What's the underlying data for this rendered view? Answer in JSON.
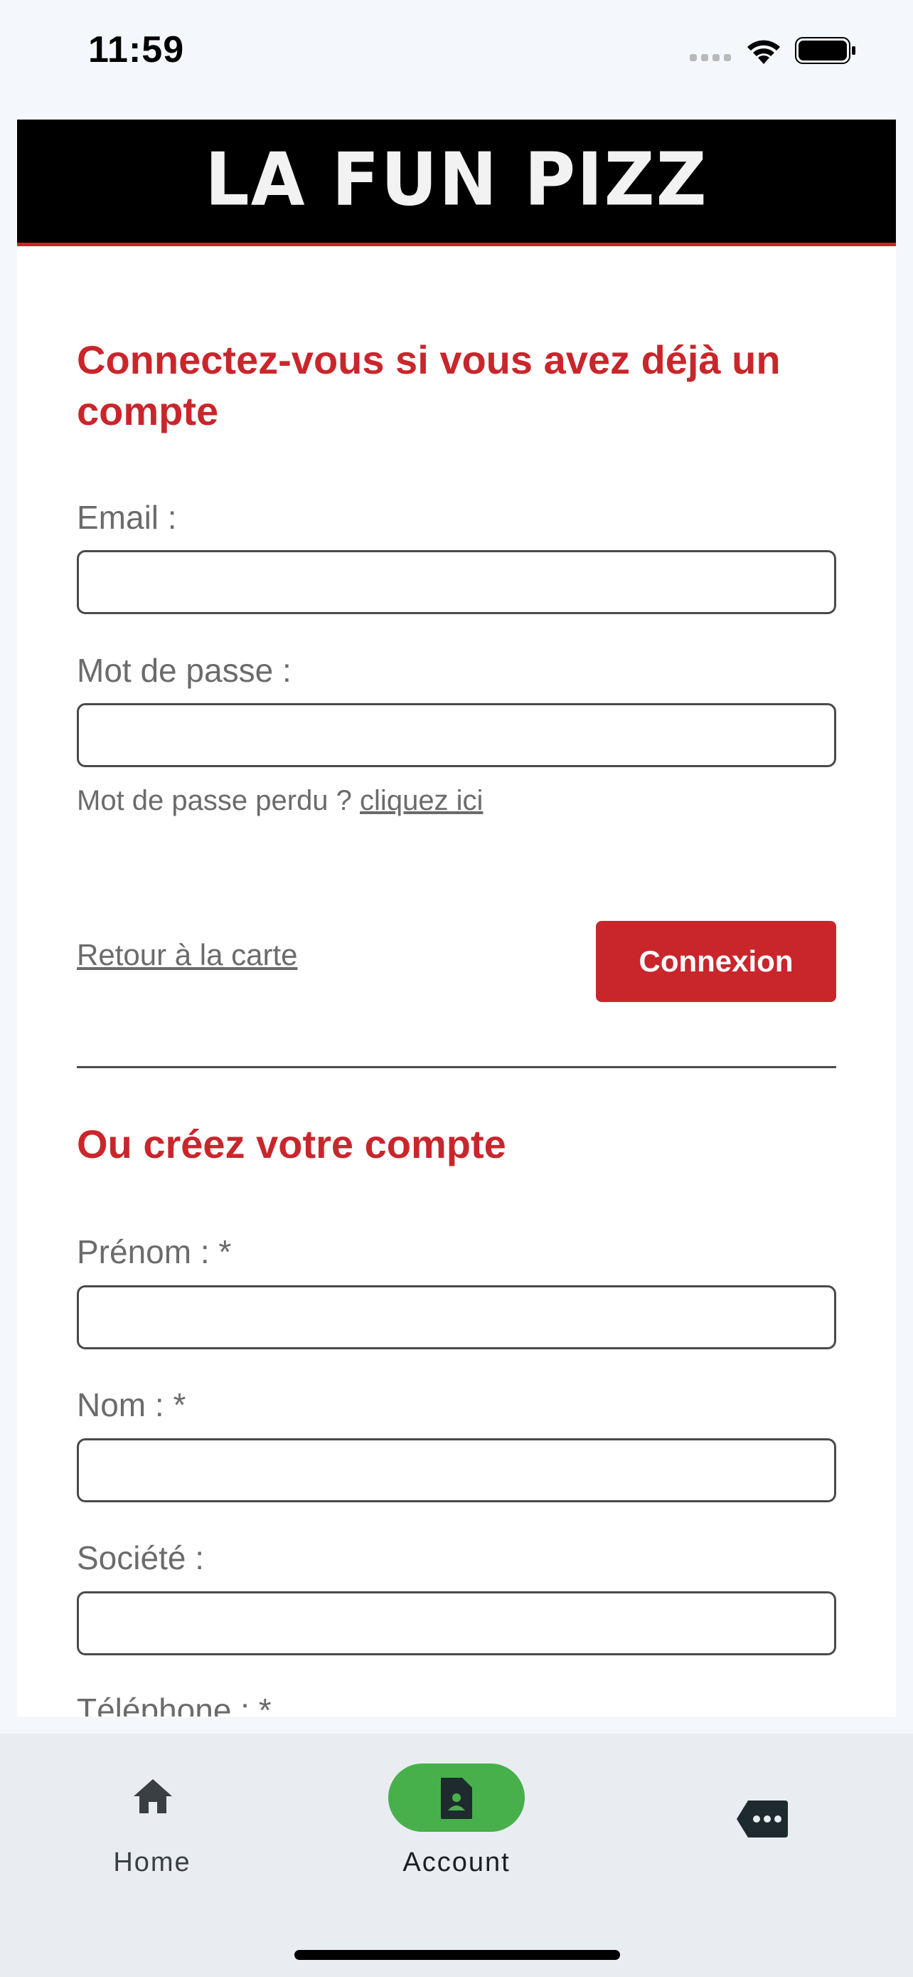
{
  "status_bar": {
    "time": "11:59"
  },
  "header": {
    "logo_text": "LA FUN PIZZ"
  },
  "login": {
    "title": "Connectez-vous si vous avez déjà un compte",
    "email_label": "Email :",
    "email_value": "",
    "password_label": "Mot de passe :",
    "password_value": "",
    "forgot_text": "Mot de passe perdu ?",
    "forgot_link": "cliquez ici",
    "back_link": "Retour à la carte",
    "submit_label": "Connexion"
  },
  "register": {
    "title": "Ou créez votre compte",
    "firstname_label": "Prénom : *",
    "lastname_label": "Nom : *",
    "company_label": "Société :",
    "phone_label": "Téléphone : *"
  },
  "tab_bar": {
    "items": [
      {
        "label": "Home",
        "icon": "home-icon"
      },
      {
        "label": "Account",
        "icon": "account-badge-icon",
        "active": true
      },
      {
        "label": "",
        "icon": "more-messages-icon"
      }
    ],
    "active_color": "#47b04b"
  },
  "colors": {
    "accent": "#c9262c",
    "banner": "#000000"
  }
}
